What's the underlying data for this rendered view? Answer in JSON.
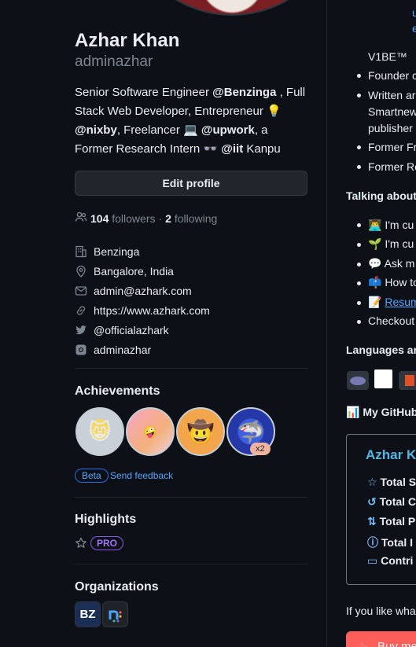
{
  "profile": {
    "name": "Azhar Khan",
    "username": "adminazhar",
    "bio": {
      "t1": "Senior Software Engineer ",
      "m1": "@Benzinga",
      "t2": " , Full Stack Web Developer, Entrepreneur 💡 ",
      "m2": "@nixby",
      "t3": ", Freelancer 💻 ",
      "m3": "@upwork",
      "t4": ", a Former Research Intern 👓 ",
      "m4": "@iit",
      "t5": " Kanpu"
    },
    "edit_label": "Edit profile",
    "followers_count": "104",
    "followers_label": "followers",
    "dot": "·",
    "following_count": "2",
    "following_label": "following",
    "meta": {
      "company": "Benzinga",
      "location": "Bangalore, India",
      "email": "admin@azhark.com",
      "website": "https://www.azhark.com",
      "twitter": "@officialazhark",
      "instagram": "adminazhar"
    }
  },
  "achievements": {
    "title": "Achievements",
    "badge_multiplier": "x2",
    "beta_label": "Beta",
    "feedback_label": "Send feedback"
  },
  "highlights": {
    "title": "Highlights",
    "pro_label": "PRO"
  },
  "organizations": {
    "title": "Organizations",
    "org1_text": "BZ",
    "org2_text": "n:"
  },
  "readme": {
    "top1": "u",
    "top2": "e",
    "v1be": "V1BE™",
    "founder": "Founder c",
    "written": "Written ar",
    "smartnew": "Smartnew",
    "publisher": "publisher",
    "former_fr": "Former Fr",
    "former_re": "Former Re",
    "talking": "Talking about",
    "cu1": "I'm cu",
    "cu2": "I'm cu",
    "ask": "Ask m",
    "howto": "How to",
    "resume": "Resum",
    "checkout": "Checkout",
    "languages": "Languages anc",
    "github": "My GitHub",
    "card_title": "Azhar K",
    "stat1": "Total S",
    "stat2": "Total C",
    "stat3": "Total P",
    "stat4": "Total I",
    "stat5": "Contri",
    "like": "If you like wha",
    "buy": "Buy me"
  }
}
